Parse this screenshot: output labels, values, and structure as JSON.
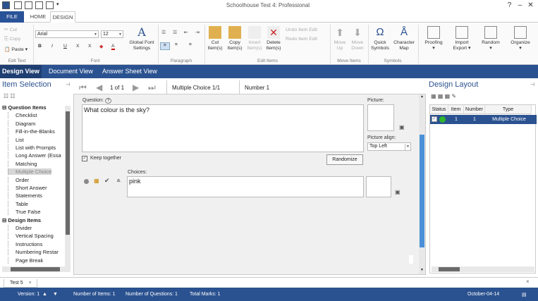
{
  "window": {
    "title": "Schoolhouse Test 4: Professional",
    "minimize": "–",
    "restore": "❐",
    "close": "✕"
  },
  "ribbon_tabs": {
    "file": "FILE",
    "home": "HOME",
    "design": "DESIGN"
  },
  "ribbon": {
    "edit_text": {
      "cut": "Cut",
      "copy": "Copy",
      "paste": "Paste",
      "label": "Edit Text"
    },
    "font": {
      "name": "Arial",
      "size": "12",
      "global_font": "Global Font Settings",
      "label": "Font",
      "bold": "B",
      "italic": "I",
      "underline": "U",
      "subscript": "X",
      "superscript": "X",
      "color": "A"
    },
    "paragraph": {
      "label": "Paragraph"
    },
    "edit_items": {
      "cut": "Cut Item(s)",
      "copy": "Copy Item(s)",
      "insert": "Insert Item(s)",
      "delete": "Delete Item(s)",
      "undo": "Undo Item Edit",
      "redo": "Redo Item Edit",
      "label": "Edit Items"
    },
    "move_items": {
      "up": "Move Up",
      "down": "Move Down",
      "label": "Move Items"
    },
    "symbols": {
      "quick": "Quick Symbols",
      "charmap": "Character Map",
      "label": "Symbols"
    },
    "proofing": "Proofing",
    "import_export": "Import Export",
    "random": "Random",
    "organize": "Organize"
  },
  "views": {
    "design": "Design View",
    "document": "Document View",
    "answer": "Answer Sheet View"
  },
  "item_selection": {
    "title": "Item Selection",
    "question_items_header": "Question Items",
    "question_items": [
      "Checklist",
      "Diagram",
      "Fill-in-the-Blanks",
      "List",
      "List with Prompts",
      "Long Answer (Essa",
      "Matching",
      "Multiple Choice",
      "Order",
      "Short Answer",
      "Statements",
      "Table",
      "True False"
    ],
    "design_items_header": "Design Items",
    "design_items": [
      "Divider",
      "Vertical Spacing",
      "Instructions",
      "Numbering Restar",
      "Page Break"
    ]
  },
  "editor": {
    "page_of": "1 of 1",
    "item_type": "Multiple Choice 1/1",
    "number": "Number 1",
    "question_label": "Question:",
    "question_text": "What colour is the sky?",
    "picture_label": "Picture:",
    "picture_align_label": "Picture align:",
    "picture_align_value": "Top Left",
    "keep_together": "Keep together",
    "randomize": "Randomize",
    "choices_label": "Choices:",
    "choice_letter": "a.",
    "choice_text": "pink"
  },
  "design_layout": {
    "title": "Design Layout",
    "columns": [
      "Status",
      "Item",
      "Number",
      "Type"
    ],
    "rows": [
      {
        "item": "1",
        "number": "1",
        "type": "Multiple Choice"
      }
    ]
  },
  "doc_tab": "Test 5",
  "status": {
    "version": "Version: 1",
    "num_items": "Number of Items: 1",
    "num_questions": "Number of Questions: 1",
    "total_marks": "Total Marks: 1",
    "date": "October-04-14"
  },
  "colors": {
    "accent": "#2b5290",
    "ribbon_bg": "#fafafa"
  }
}
